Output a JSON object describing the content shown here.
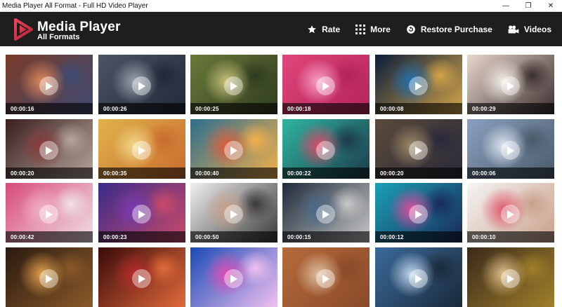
{
  "window": {
    "title": "Media Player All Format - Full HD Video Player",
    "controls": [
      "—",
      "❐",
      "✕"
    ]
  },
  "brand": {
    "name": "Media Player",
    "subtitle": "All Formats",
    "logo_colors": [
      "#c4263c",
      "#e8455a"
    ]
  },
  "actions": [
    {
      "label": "Rate",
      "icon": "star-icon"
    },
    {
      "label": "More",
      "icon": "grid-dots-icon"
    },
    {
      "label": "Restore Purchase",
      "icon": "restore-purchase-icon"
    },
    {
      "label": "Videos",
      "icon": "video-camera-icon"
    }
  ],
  "videos": [
    {
      "duration": "00:00:16",
      "colors": [
        "#7a3b28",
        "#e08a5c",
        "#3d4a73"
      ]
    },
    {
      "duration": "00:00:26",
      "colors": [
        "#4b5563",
        "#9ca3af",
        "#1f2937"
      ]
    },
    {
      "duration": "00:00:25",
      "colors": [
        "#6b7a3a",
        "#c7c27a",
        "#2f3b1f"
      ]
    },
    {
      "duration": "00:00:18",
      "colors": [
        "#e0457a",
        "#f7a1c4",
        "#b3245a"
      ]
    },
    {
      "duration": "00:00:08",
      "colors": [
        "#0b1e3a",
        "#1f6fb2",
        "#d4a44a"
      ]
    },
    {
      "duration": "00:00:29",
      "colors": [
        "#e8d7cc",
        "#f5efe9",
        "#3b2f2f"
      ]
    },
    {
      "duration": "00:00:20",
      "colors": [
        "#3a1f1f",
        "#8a3b3b",
        "#b5a59a"
      ]
    },
    {
      "duration": "00:00:35",
      "colors": [
        "#e0b24a",
        "#f3d98a",
        "#c96b2f"
      ]
    },
    {
      "duration": "00:00:40",
      "colors": [
        "#2c6e8f",
        "#e05a3a",
        "#f4b04a"
      ]
    },
    {
      "duration": "00:00:22",
      "colors": [
        "#2fb5a0",
        "#e04a6a",
        "#1c3b4a"
      ]
    },
    {
      "duration": "00:00:20",
      "colors": [
        "#5a4a3a",
        "#a08a6a",
        "#2a2a3a"
      ]
    },
    {
      "duration": "00:00:06",
      "colors": [
        "#8aa0c0",
        "#dfe7f1",
        "#4a5a6a"
      ]
    },
    {
      "duration": "00:00:42",
      "colors": [
        "#d94a7a",
        "#f1b0c8",
        "#f0e0e8"
      ]
    },
    {
      "duration": "00:00:23",
      "colors": [
        "#3a2b8a",
        "#7a3bb5",
        "#c94a6a"
      ]
    },
    {
      "duration": "00:00:50",
      "colors": [
        "#f0f0f0",
        "#c9a08a",
        "#3a3a3a"
      ]
    },
    {
      "duration": "00:00:15",
      "colors": [
        "#1f2a3a",
        "#4a6a8a",
        "#c7c7c7"
      ]
    },
    {
      "duration": "00:00:12",
      "colors": [
        "#1aa0b5",
        "#e04aa0",
        "#1a2a5a"
      ]
    },
    {
      "duration": "00:00:10",
      "colors": [
        "#f5f5f5",
        "#e0566a",
        "#c9a08a"
      ]
    },
    {
      "duration": "",
      "colors": [
        "#2a1a10",
        "#e0a04a",
        "#8a5a2a"
      ]
    },
    {
      "duration": "",
      "colors": [
        "#3a0a0a",
        "#b52a2a",
        "#e06a3a"
      ]
    },
    {
      "duration": "",
      "colors": [
        "#1a4ab5",
        "#e04ab5",
        "#f0c0f0"
      ]
    },
    {
      "duration": "",
      "colors": [
        "#b56a3a",
        "#e0c0a0",
        "#8a4a2a"
      ]
    },
    {
      "duration": "",
      "colors": [
        "#3a6a9a",
        "#c0d8f0",
        "#1a2a3a"
      ]
    },
    {
      "duration": "",
      "colors": [
        "#3a2a1a",
        "#e0c08a",
        "#a0802a"
      ]
    }
  ]
}
